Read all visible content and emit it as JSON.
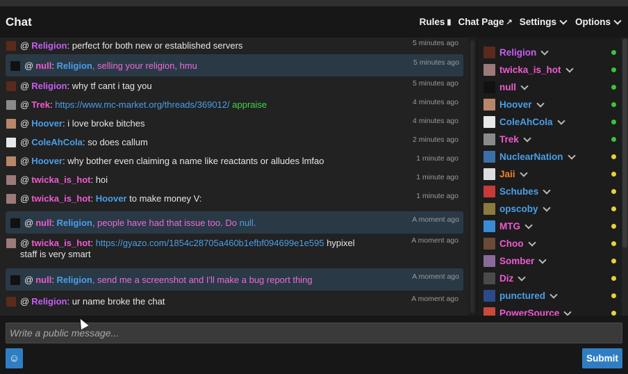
{
  "header": {
    "title": "Chat",
    "nav": [
      {
        "label": "Rules",
        "icon": "book-icon"
      },
      {
        "label": "Chat Page",
        "icon": "external-link-icon"
      },
      {
        "label": "Settings",
        "icon": "chevron-down-icon"
      },
      {
        "label": "Options",
        "icon": "chevron-down-icon"
      }
    ]
  },
  "messages": [
    {
      "user": "Religion",
      "userColor": "purple",
      "time": "5 minutes ago",
      "highlight": false,
      "avatarColor": "#5a2a1c",
      "parts": [
        {
          "t": "perfect for both new or established servers",
          "c": ""
        }
      ]
    },
    {
      "user": "null",
      "userColor": "pink",
      "time": "5 minutes ago",
      "highlight": true,
      "avatarColor": "#111111",
      "parts": [
        {
          "t": "Religion",
          "c": "u-blue"
        },
        {
          "t": ", selling your religion, hmu",
          "c": "t-pink"
        }
      ]
    },
    {
      "user": "Religion",
      "userColor": "purple",
      "time": "5 minutes ago",
      "highlight": false,
      "avatarColor": "#5a2a1c",
      "parts": [
        {
          "t": "why tf cant i tag you",
          "c": ""
        }
      ]
    },
    {
      "user": "Trek",
      "userColor": "pink",
      "time": "4 minutes ago",
      "highlight": false,
      "avatarColor": "#8a8a8a",
      "parts": [
        {
          "t": "https://www.mc-market.org/threads/369012/",
          "c": "t-link"
        },
        {
          "t": " appraise",
          "c": "t-green"
        }
      ]
    },
    {
      "user": "Hoover",
      "userColor": "blue",
      "time": "4 minutes ago",
      "highlight": false,
      "avatarColor": "#b8866a",
      "parts": [
        {
          "t": "i love broke bitches",
          "c": ""
        }
      ]
    },
    {
      "user": "ColeAhCola",
      "userColor": "blue",
      "time": "2 minutes ago",
      "highlight": false,
      "avatarColor": "#e8e8e8",
      "parts": [
        {
          "t": "so does callum",
          "c": ""
        }
      ]
    },
    {
      "user": "Hoover",
      "userColor": "blue",
      "time": "1 minute ago",
      "highlight": false,
      "avatarColor": "#b8866a",
      "parts": [
        {
          "t": "why bother even claiming a name like reactants or alludes lmfao",
          "c": ""
        }
      ]
    },
    {
      "user": "twicka_is_hot",
      "userColor": "pink",
      "time": "1 minute ago",
      "highlight": false,
      "avatarColor": "#9c7a7a",
      "parts": [
        {
          "t": "hoi",
          "c": ""
        }
      ]
    },
    {
      "user": "twicka_is_hot",
      "userColor": "pink",
      "time": "1 minute ago",
      "highlight": false,
      "avatarColor": "#9c7a7a",
      "parts": [
        {
          "t": "Hoover",
          "c": "u-blue"
        },
        {
          "t": " to make money V:",
          "c": ""
        }
      ]
    },
    {
      "user": "null",
      "userColor": "pink",
      "time": "A moment ago",
      "highlight": true,
      "avatarColor": "#111111",
      "parts": [
        {
          "t": "Religion",
          "c": "u-blue"
        },
        {
          "t": ", people have had that issue too. Do ",
          "c": "t-pink"
        },
        {
          "t": "null",
          "c": "t-link"
        },
        {
          "t": ".",
          "c": "t-pink"
        }
      ]
    },
    {
      "user": "twicka_is_hot",
      "userColor": "pink",
      "time": "A moment ago",
      "highlight": false,
      "avatarColor": "#9c7a7a",
      "parts": [
        {
          "t": "https://gyazo.com/1854c28705a460b1efbf094699e1e595",
          "c": "t-link"
        },
        {
          "t": " hypixel staff is very smart",
          "c": ""
        }
      ]
    },
    {
      "user": "null",
      "userColor": "pink",
      "time": "A moment ago",
      "highlight": true,
      "avatarColor": "#111111",
      "parts": [
        {
          "t": "Religion",
          "c": "u-blue"
        },
        {
          "t": ", send me a screenshot and I'll make a bug report thing",
          "c": "t-pink"
        }
      ]
    },
    {
      "user": "Religion",
      "userColor": "purple",
      "time": "A moment ago",
      "highlight": false,
      "avatarColor": "#5a2a1c",
      "parts": [
        {
          "t": "ur name broke the chat",
          "c": ""
        }
      ]
    }
  ],
  "users": [
    {
      "name": "Religion",
      "color": "#c75df4",
      "status": "#39c43b",
      "avatarColor": "#5a2a1c"
    },
    {
      "name": "twicka_is_hot",
      "color": "#f05ad2",
      "status": "#39c43b",
      "avatarColor": "#9c7a7a"
    },
    {
      "name": "null",
      "color": "#f05ad2",
      "status": "#39c43b",
      "avatarColor": "#111111"
    },
    {
      "name": "Hoover",
      "color": "#4a9fe8",
      "status": "#39c43b",
      "avatarColor": "#b8866a"
    },
    {
      "name": "ColeAhCola",
      "color": "#4a9fe8",
      "status": "#39c43b",
      "avatarColor": "#e8e8e8"
    },
    {
      "name": "Trek",
      "color": "#f05ad2",
      "status": "#39c43b",
      "avatarColor": "#8a8a8a"
    },
    {
      "name": "NuclearNation",
      "color": "#4a9fe8",
      "status": "#e6d23a",
      "avatarColor": "#3b6fa8"
    },
    {
      "name": "Jaii",
      "color": "#f0822d",
      "status": "#e6d23a",
      "avatarColor": "#dddddd"
    },
    {
      "name": "Schubes",
      "color": "#4a9fe8",
      "status": "#e6d23a",
      "avatarColor": "#c63a3a"
    },
    {
      "name": "opscoby",
      "color": "#4a9fe8",
      "status": "#e6d23a",
      "avatarColor": "#8c7a3e"
    },
    {
      "name": "MTG",
      "color": "#f05ad2",
      "status": "#e6d23a",
      "avatarColor": "#3a8ad6"
    },
    {
      "name": "Choo",
      "color": "#f05ad2",
      "status": "#e6d23a",
      "avatarColor": "#6a4a3a"
    },
    {
      "name": "Somber",
      "color": "#f05ad2",
      "status": "#e6d23a",
      "avatarColor": "#8a6a9a"
    },
    {
      "name": "Diz",
      "color": "#f05ad2",
      "status": "#e6d23a",
      "avatarColor": "#4a4a4a"
    },
    {
      "name": "punctured",
      "color": "#4a9fe8",
      "status": "#e6d23a",
      "avatarColor": "#2a4a8a"
    },
    {
      "name": "PowerSource",
      "color": "#f05ad2",
      "status": "#e6d23a",
      "avatarColor": "#c84a3a"
    }
  ],
  "composer": {
    "placeholder": "Write a public message...",
    "submit_label": "Submit",
    "emoji_icon": "smiley-icon"
  }
}
